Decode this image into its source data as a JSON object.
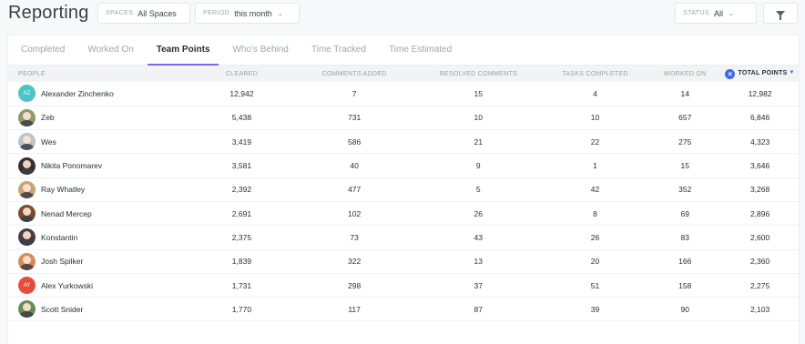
{
  "header": {
    "title": "Reporting",
    "spaces_label": "SPACES",
    "spaces_value": "All Spaces",
    "period_label": "PERIOD",
    "period_value": "this month",
    "status_label": "STATUS",
    "status_value": "All"
  },
  "tabs": [
    "Completed",
    "Worked On",
    "Team Points",
    "Who's Behind",
    "Time Tracked",
    "Time Estimated"
  ],
  "active_tab": "Team Points",
  "columns": {
    "people": "PEOPLE",
    "cleared": "CLEARED",
    "comments_added": "COMMENTS ADDED",
    "resolved_comments": "RESOLVED COMMENTS",
    "tasks_completed": "TASKS COMPLETED",
    "worked_on": "WORKED ON",
    "total_points": "TOTAL POINTS"
  },
  "rows": [
    {
      "name": "Alexander Zinchenko",
      "initials": "AZ",
      "avatar_color": "#49c6c5",
      "photo": false,
      "cleared": "12,942",
      "comments_added": "7",
      "resolved_comments": "15",
      "tasks_completed": "4",
      "worked_on": "14",
      "total_points": "12,982"
    },
    {
      "name": "Zeb",
      "initials": "",
      "avatar_color": "#8a9a6a",
      "photo": true,
      "cleared": "5,438",
      "comments_added": "731",
      "resolved_comments": "10",
      "tasks_completed": "10",
      "worked_on": "657",
      "total_points": "6,846"
    },
    {
      "name": "Wes",
      "initials": "",
      "avatar_color": "#b9c3cc",
      "photo": true,
      "cleared": "3,419",
      "comments_added": "586",
      "resolved_comments": "21",
      "tasks_completed": "22",
      "worked_on": "275",
      "total_points": "4,323"
    },
    {
      "name": "Nikita Ponomarev",
      "initials": "",
      "avatar_color": "#3a2e2a",
      "photo": true,
      "cleared": "3,581",
      "comments_added": "40",
      "resolved_comments": "9",
      "tasks_completed": "1",
      "worked_on": "15",
      "total_points": "3,646"
    },
    {
      "name": "Ray Whatley",
      "initials": "",
      "avatar_color": "#c9a27a",
      "photo": true,
      "cleared": "2,392",
      "comments_added": "477",
      "resolved_comments": "5",
      "tasks_completed": "42",
      "worked_on": "352",
      "total_points": "3,268"
    },
    {
      "name": "Nenad Mercep",
      "initials": "",
      "avatar_color": "#7a4a32",
      "photo": true,
      "cleared": "2,691",
      "comments_added": "102",
      "resolved_comments": "26",
      "tasks_completed": "8",
      "worked_on": "69",
      "total_points": "2,896"
    },
    {
      "name": "Konstantin",
      "initials": "",
      "avatar_color": "#4a3a44",
      "photo": true,
      "cleared": "2,375",
      "comments_added": "73",
      "resolved_comments": "43",
      "tasks_completed": "26",
      "worked_on": "83",
      "total_points": "2,600"
    },
    {
      "name": "Josh Spilker",
      "initials": "",
      "avatar_color": "#d98a5a",
      "photo": true,
      "cleared": "1,839",
      "comments_added": "322",
      "resolved_comments": "13",
      "tasks_completed": "20",
      "worked_on": "166",
      "total_points": "2,360"
    },
    {
      "name": "Alex Yurkowski",
      "initials": "AY",
      "avatar_color": "#e84c3d",
      "photo": false,
      "cleared": "1,731",
      "comments_added": "298",
      "resolved_comments": "37",
      "tasks_completed": "51",
      "worked_on": "158",
      "total_points": "2,275"
    },
    {
      "name": "Scott Snider",
      "initials": "",
      "avatar_color": "#6a8a5a",
      "photo": true,
      "cleared": "1,770",
      "comments_added": "117",
      "resolved_comments": "87",
      "tasks_completed": "39",
      "worked_on": "90",
      "total_points": "2,103"
    }
  ],
  "icons": {
    "sort_clear": "close-circle-icon",
    "sort_direction": "caret-down-icon",
    "filter": "funnel-icon",
    "dropdown": "chevron-down-icon"
  },
  "colors": {
    "accent": "#7b68ee",
    "sort_blue": "#4169e1"
  }
}
